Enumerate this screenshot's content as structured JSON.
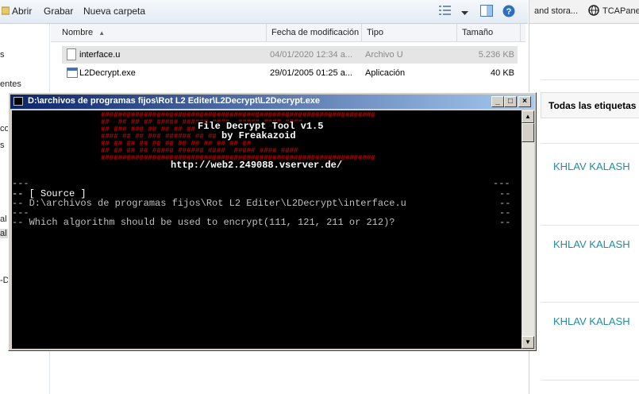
{
  "explorer": {
    "toolbar": {
      "open_label": "Abrir",
      "record_label": "Grabar",
      "new_folder_label": "Nueva carpeta"
    },
    "nav_fragments": [
      "s",
      "entes",
      "co",
      "s",
      "al (",
      "al (",
      "-D"
    ],
    "columns": {
      "name": "Nombre",
      "date": "Fecha de modificación",
      "type": "Tipo",
      "size": "Tamaño"
    },
    "files": [
      {
        "name": "interface.u",
        "date": "04/01/2020 12:34 a...",
        "type": "Archivo U",
        "size": "5.236 KB",
        "selected": true
      },
      {
        "name": "L2Decrypt.exe",
        "date": "29/01/2005 01:25 a...",
        "type": "Aplicación",
        "size": "40 KB",
        "selected": false
      }
    ]
  },
  "right_page": {
    "tabs": [
      "and stora...",
      "TCAPane"
    ],
    "tags_label": "Todas las etiquetas",
    "links": [
      "KHLAV KALASH",
      "KHLAV KALASH",
      "KHLAV KALASH"
    ]
  },
  "console": {
    "title": "D:\\archivos de programas fijos\\Rot L2 Editer\\L2Decrypt\\L2Decrypt.exe",
    "banner_title": "File Decrypt Tool v1.5",
    "banner_author": "by Freakazoid",
    "url": "http://web2.249088.vserver.de/",
    "source_label": "-- [ Source ]",
    "source_path": "-- D:\\archivos de programas fijos\\Rot L2 Editer\\L2Decrypt\\interface.u",
    "prompt": "-- Which algorithm should be used to encrypt(111, 121, 211 or 212)?",
    "dash_line": "---",
    "dash_short": "--",
    "dash_long": "---",
    "banner_rows": [
      "################################################################",
      "##  ## ## ## ##### ###### ####  ##### #### ####",
      "## ### ### ## ## ## ## ## ## ## ## ## ##",
      "#### ## ## ### ###### ## ## ##### ### ##",
      "## ## ## ## ## ## ## ## ## ## ## ##",
      "## ## ## ## ##### ###### ####  ##### #### ####",
      "################################################################"
    ],
    "text_color": "#c0c0c0",
    "banner_color": "#c00000"
  }
}
